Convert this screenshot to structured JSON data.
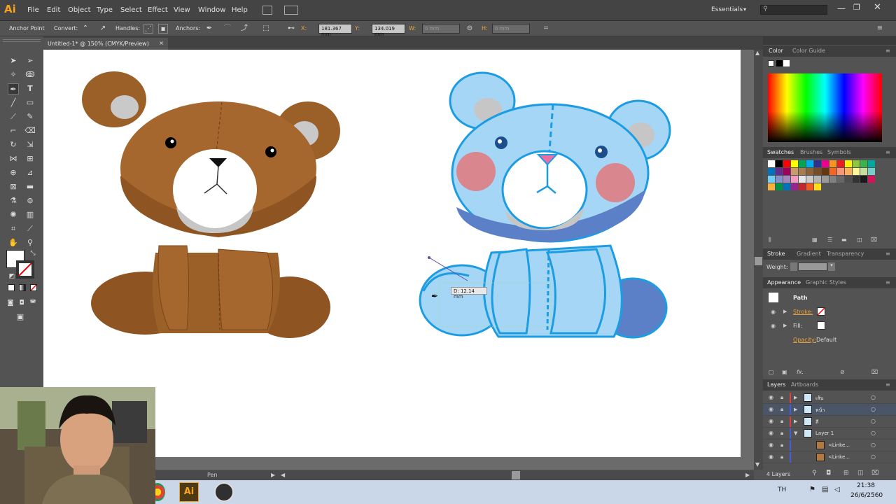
{
  "menubar": {
    "logo": "Ai",
    "menus": [
      "File",
      "Edit",
      "Object",
      "Type",
      "Select",
      "Effect",
      "View",
      "Window",
      "Help"
    ],
    "workspace": "Essentials",
    "search_placeholder": ""
  },
  "control_bar": {
    "anchor_point_label": "Anchor Point",
    "convert_label": "Convert:",
    "handles_label": "Handles:",
    "anchors_label": "Anchors:",
    "x_label": "X:",
    "x_value": "181.367 mm",
    "y_label": "Y:",
    "y_value": "134.019 mm",
    "w_label": "W:",
    "w_value": "0 mm",
    "h_label": "H:",
    "h_value": "0 mm"
  },
  "document": {
    "tab_title": "Untitled-1* @ 150% (CMYK/Preview)",
    "tab_close": "×",
    "measure_tooltip": "D: 12.14 mm"
  },
  "status": {
    "tool_name": "Pen"
  },
  "panels": {
    "color_tabs": [
      "Color",
      "Color Guide"
    ],
    "swatch_tabs": [
      "Swatches",
      "Brushes",
      "Symbols"
    ],
    "stroke_tabs": [
      "Stroke",
      "Gradient",
      "Transparency"
    ],
    "weight_label": "Weight:",
    "appearance_tabs": [
      "Appearance",
      "Graphic Styles"
    ],
    "appearance_title": "Path",
    "stroke_label": "Stroke:",
    "fill_label": "Fill:",
    "opacity_label": "Opacity:",
    "opacity_value": "Default",
    "layers_tabs": [
      "Layers",
      "Artboards"
    ],
    "layers": [
      {
        "name": "เส้น",
        "color": "#e04040"
      },
      {
        "name": "หน้า",
        "color": "#4060e0"
      },
      {
        "name": "สี",
        "color": "#e04040"
      },
      {
        "name": "Layer 1",
        "color": "#4060e0"
      },
      {
        "name": "<Linke...",
        "color": "#4060e0"
      },
      {
        "name": "<Linke...",
        "color": "#4060e0"
      }
    ],
    "layers_count": "4 Layers"
  },
  "taskbar": {
    "lang": "TH",
    "time": "21:38",
    "date": "26/6/2560",
    "ai_label": "Ai"
  },
  "swatch_colors": [
    "#ffffff",
    "#000000",
    "#ff0000",
    "#ffff00",
    "#00a651",
    "#00aeef",
    "#2e3192",
    "#ec008c",
    "#f7941d",
    "#ed1c24",
    "#fff200",
    "#8dc63f",
    "#39b54a",
    "#00a99d",
    "#0072bc",
    "#662d91",
    "#9e005d",
    "#c69c6d",
    "#a67c52",
    "#8c6239",
    "#754c24",
    "#603913",
    "#f26522",
    "#f7977a",
    "#fbaf5d",
    "#fff799",
    "#c4df9b",
    "#7accc8",
    "#6dcff6",
    "#8393ca",
    "#a187be",
    "#f49ac2",
    "#e6e6e6",
    "#cccccc",
    "#b3b3b3",
    "#999999",
    "#808080",
    "#666666",
    "#4d4d4d",
    "#333333",
    "#1a1a1a",
    "#d4145a",
    "#fbb03b",
    "#009245",
    "#0071bc",
    "#93278f",
    "#c1272d",
    "#f15a24",
    "#ffde17"
  ]
}
